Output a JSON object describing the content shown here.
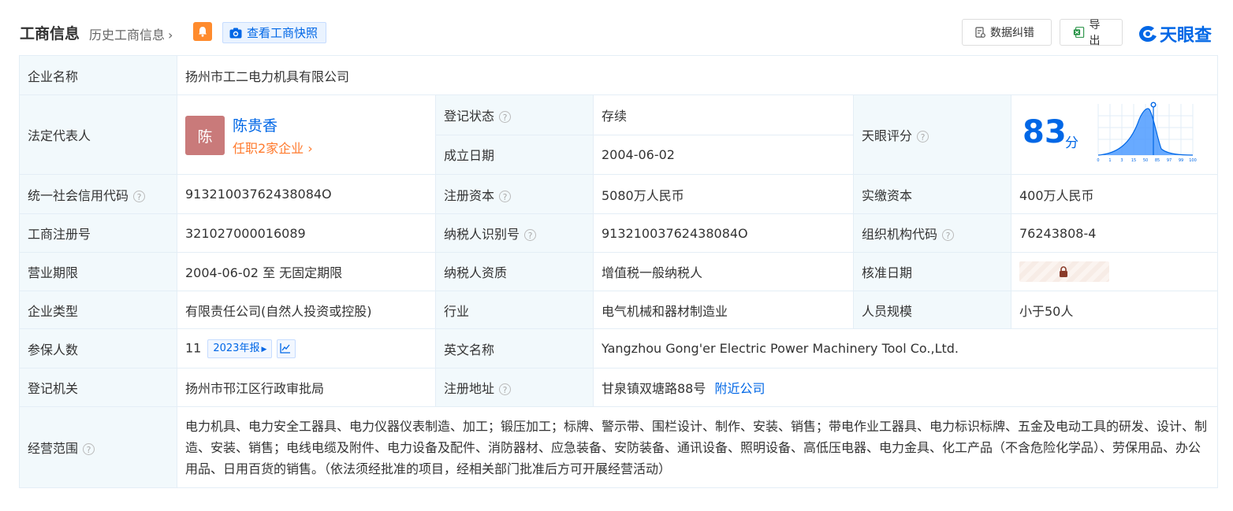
{
  "header": {
    "title": "工商信息",
    "history_link": "历史工商信息",
    "snapshot_button": "查看工商快照",
    "data_fix_button": "数据纠错",
    "export_button": "导出",
    "logo_text": "天眼查",
    "accent_color": "#0067e6"
  },
  "rows": {
    "company_name_label": "企业名称",
    "company_name": "扬州市工二电力机具有限公司",
    "legal_rep_label": "法定代表人",
    "legal_rep_avatar": "陈",
    "legal_rep_name": "陈贵香",
    "legal_rep_link": "任职2家企业",
    "reg_status_label": "登记状态",
    "reg_status": "存续",
    "found_date_label": "成立日期",
    "found_date": "2004-06-02",
    "tianyan_score_label": "天眼评分",
    "score": "83",
    "score_unit": "分",
    "score_ticks": [
      "0",
      "1",
      "3",
      "15",
      "50",
      "85",
      "97",
      "99",
      "100"
    ],
    "credit_code_label": "统一社会信用代码",
    "credit_code": "91321003762438084O",
    "reg_capital_label": "注册资本",
    "reg_capital": "5080万人民币",
    "paid_capital_label": "实缴资本",
    "paid_capital": "400万人民币",
    "biz_reg_no_label": "工商注册号",
    "biz_reg_no": "321027000016089",
    "taxpayer_id_label": "纳税人识别号",
    "taxpayer_id": "91321003762438084O",
    "org_code_label": "组织机构代码",
    "org_code": "76243808-4",
    "biz_term_label": "营业期限",
    "biz_term": "2004-06-02 至 无固定期限",
    "taxpayer_qual_label": "纳税人资质",
    "taxpayer_qual": "增值税一般纳税人",
    "approval_date_label": "核准日期",
    "company_type_label": "企业类型",
    "company_type": "有限责任公司(自然人投资或控股)",
    "industry_label": "行业",
    "industry": "电气机械和器材制造业",
    "staff_size_label": "人员规模",
    "staff_size": "小于50人",
    "insured_label": "参保人数",
    "insured_count": "11",
    "insured_report": "2023年报",
    "english_name_label": "英文名称",
    "english_name": "Yangzhou Gong'er Electric Power Machinery Tool Co.,Ltd.",
    "reg_authority_label": "登记机关",
    "reg_authority": "扬州市邗江区行政审批局",
    "reg_address_label": "注册地址",
    "reg_address": "甘泉镇双塘路88号",
    "nearby_link": "附近公司",
    "scope_label": "经营范围",
    "scope": "电力机具、电力安全工器具、电力仪器仪表制造、加工；锻压加工；标牌、警示带、围栏设计、制作、安装、销售；带电作业工器具、电力标识标牌、五金及电动工具的研发、设计、制造、安装、销售；电线电缆及附件、电力设备及配件、消防器材、应急装备、安防装备、通讯设备、照明设备、高低压电器、电力金具、化工产品（不含危险化学品）、劳保用品、办公用品、日用百货的销售。（依法须经批准的项目，经相关部门批准后方可开展经营活动）"
  }
}
